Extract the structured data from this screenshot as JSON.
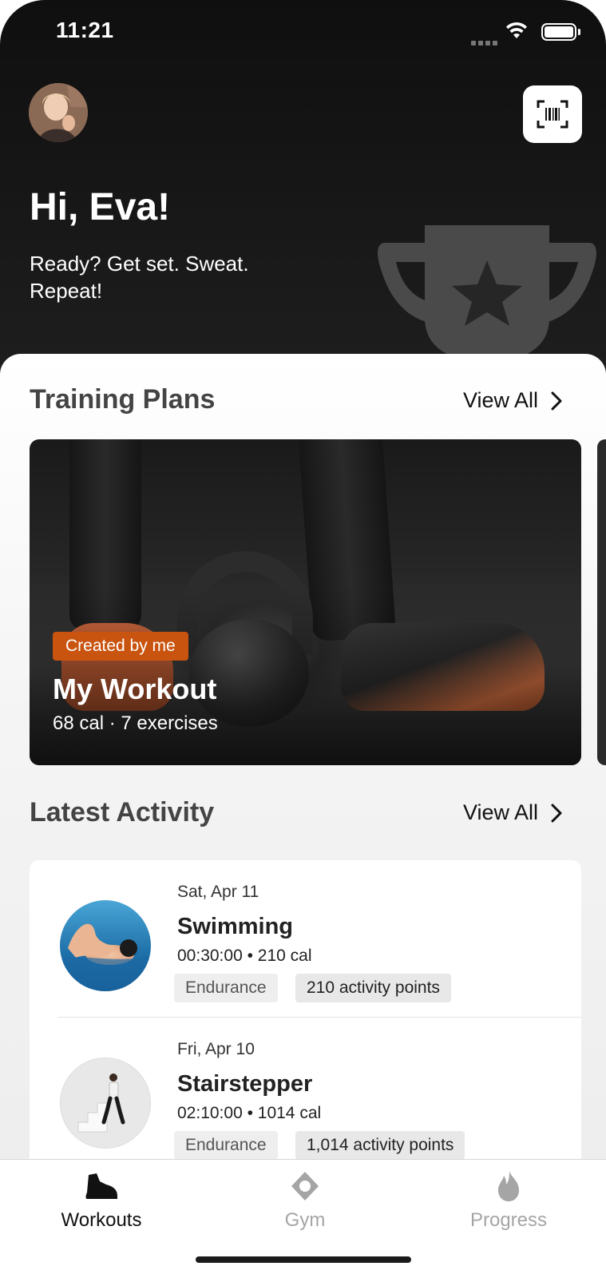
{
  "status_bar": {
    "time": "11:21"
  },
  "header": {
    "greeting": "Hi, Eva!",
    "subtitle": "Ready? Get set. Sweat. Repeat!"
  },
  "training_plans": {
    "title": "Training Plans",
    "view_all": "View All",
    "cards": [
      {
        "badge": "Created by me",
        "title": "My Workout",
        "meta": "68 cal · 7 exercises"
      }
    ]
  },
  "latest_activity": {
    "title": "Latest Activity",
    "view_all": "View All",
    "items": [
      {
        "date": "Sat, Apr 11",
        "title": "Swimming",
        "meta": "00:30:00 • 210 cal",
        "tag": "Endurance",
        "points": "210 activity points"
      },
      {
        "date": "Fri, Apr 10",
        "title": "Stairstepper",
        "meta": "02:10:00 • 1014 cal",
        "tag": "Endurance",
        "points": "1,014 activity points"
      }
    ]
  },
  "tabbar": {
    "tabs": [
      {
        "label": "Workouts",
        "icon": "shoe-icon",
        "active": true
      },
      {
        "label": "Gym",
        "icon": "location-pin-icon",
        "active": false
      },
      {
        "label": "Progress",
        "icon": "flame-icon",
        "active": false
      }
    ]
  },
  "colors": {
    "accent": "#c9540f",
    "header_bg": "#141414",
    "inactive_tab": "#a5a5a5"
  }
}
